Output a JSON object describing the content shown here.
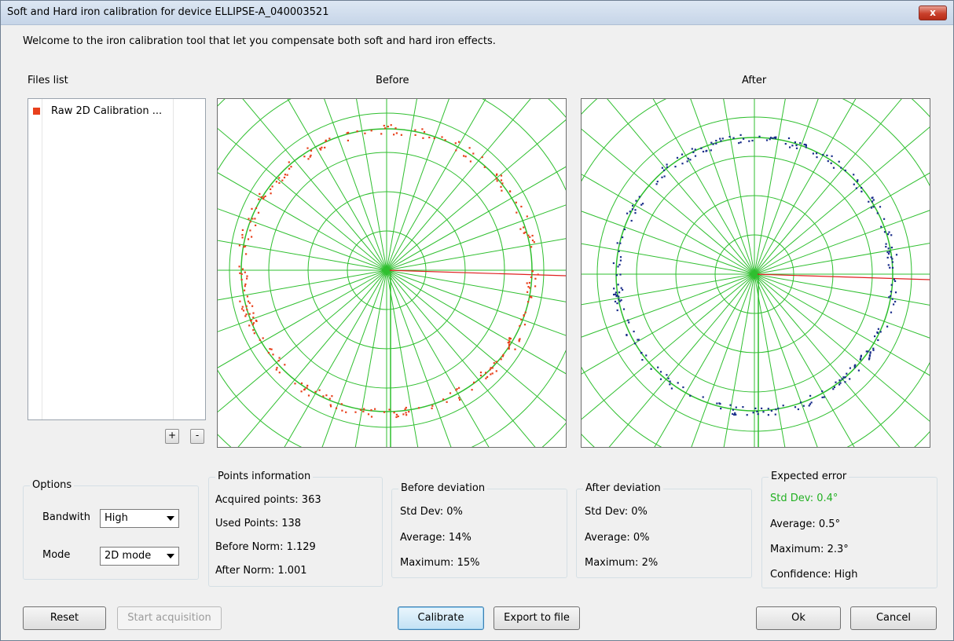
{
  "window": {
    "title": "Soft and Hard iron calibration for device ELLIPSE-A_040003521",
    "close_label": "x"
  },
  "welcome": "Welcome to the iron calibration tool that let you compensate both soft and hard iron effects.",
  "files": {
    "label": "Files list",
    "items": [
      "Raw 2D Calibration ..."
    ],
    "add_label": "+",
    "remove_label": "-"
  },
  "plots": {
    "before_label": "Before",
    "after_label": "After",
    "before_color": "#e8401c",
    "after_color": "#1a2d8a"
  },
  "options": {
    "title": "Options",
    "bandwith_label": "Bandwith",
    "bandwith_value": "High",
    "mode_label": "Mode",
    "mode_value": "2D mode"
  },
  "points_info": {
    "title": "Points information",
    "rows": [
      "Acquired points: 363",
      "Used Points: 138",
      "Before Norm: 1.129",
      "After Norm: 1.001"
    ]
  },
  "before_deviation": {
    "title": "Before deviation",
    "rows": [
      "Std Dev: 0%",
      "Average: 14%",
      "Maximum: 15%"
    ]
  },
  "after_deviation": {
    "title": "After deviation",
    "rows": [
      "Std Dev: 0%",
      "Average: 0%",
      "Maximum: 2%"
    ]
  },
  "expected_error": {
    "title": "Expected error",
    "rows": [
      "Std Dev: 0.4°",
      "Average: 0.5°",
      "Maximum: 2.3°",
      "Confidence: High"
    ],
    "highlight_color": "#22b022"
  },
  "buttons": {
    "reset": "Reset",
    "start": "Start acquisition",
    "calibrate": "Calibrate",
    "export": "Export to file",
    "ok": "Ok",
    "cancel": "Cancel"
  }
}
